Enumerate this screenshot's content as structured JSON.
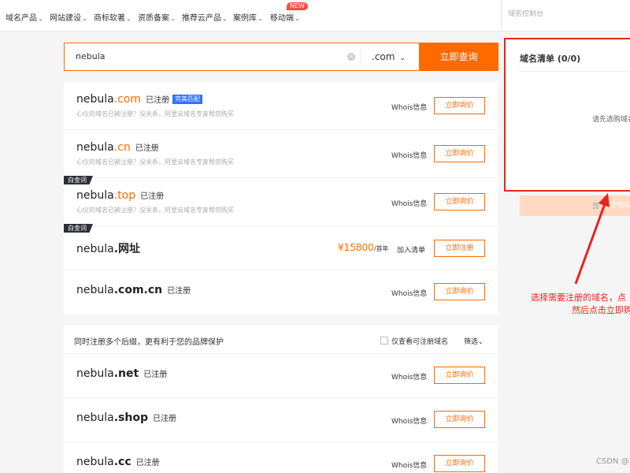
{
  "nav": {
    "items": [
      "域名产品",
      "网站建设",
      "商标软著",
      "资质备案",
      "推荐云产品",
      "案例库",
      "移动端"
    ],
    "new_badge": "NEW",
    "console_placeholder": "域名控制台"
  },
  "search": {
    "value": "nebula",
    "suffix": ".com",
    "button": "立即查询"
  },
  "common": {
    "registered": "已注册",
    "whois": "Whois信息",
    "inquire": "立即询价",
    "register": "立即注册",
    "add_to_list": "加入清单",
    "sub_note": "心仪的域名已被注册？没关系，阿里云域名专家帮您购买",
    "gold_tag": "白金词",
    "perfect_match": "完美匹配"
  },
  "results": [
    {
      "name": "nebula",
      "tld": ".com",
      "status": "已注册",
      "badge": "完美匹配"
    },
    {
      "name": "nebula",
      "tld": ".cn",
      "status": "已注册"
    },
    {
      "name": "nebula",
      "tld": ".top",
      "status": "已注册",
      "tag": "白金词"
    },
    {
      "name": "nebula",
      "tld": ".网址",
      "tag": "白金词",
      "price": "¥15800",
      "price_unit": "/首年"
    },
    {
      "name": "nebula",
      "tld": ".com.cn",
      "status": "已注册"
    }
  ],
  "multi": {
    "title": "同时注册多个后缀，更有利于您的品牌保护",
    "checkbox_label": "仅查看可注册域名",
    "filter": "筛选",
    "rows": [
      {
        "name": "nebula",
        "tld": ".net",
        "status": "已注册"
      },
      {
        "name": "nebula",
        "tld": ".shop",
        "status": "已注册"
      },
      {
        "name": "nebula",
        "tld": ".cc",
        "status": "已注册"
      }
    ]
  },
  "cart": {
    "title": "域名清单 (0/0)",
    "empty": "请先选购域名",
    "buy_button": "立即购买"
  },
  "annotation": {
    "line1": "选择需要注册的域名，点",
    "line2": "然后点击立即购"
  },
  "watermark": "CSDN @",
  "colors": {
    "accent": "#ff6a00",
    "annotation": "#e8241e",
    "badge": "#2b73ff"
  }
}
